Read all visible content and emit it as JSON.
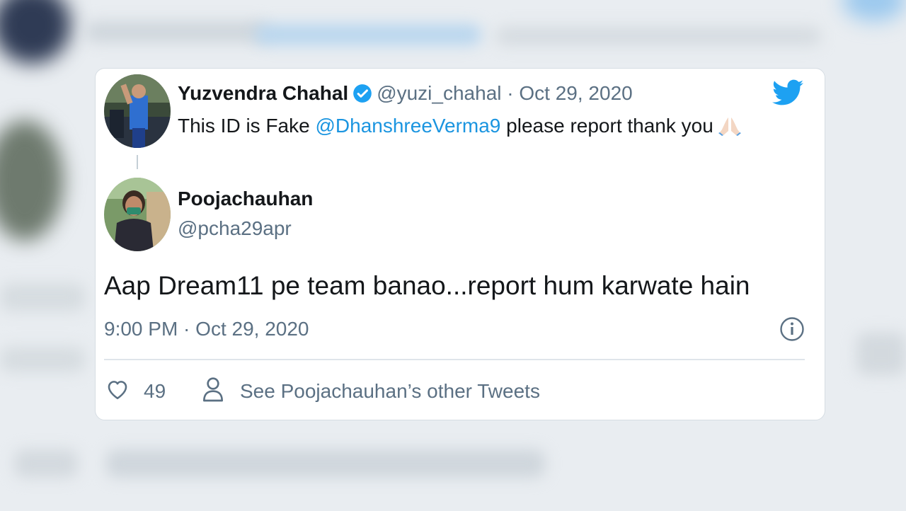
{
  "quoted_tweet": {
    "author_name": "Yuzvendra Chahal",
    "author_handle": "@yuzi_chahal",
    "separator": "·",
    "date": "Oct 29, 2020",
    "text_before": "This ID is Fake",
    "mention": "@DhanshreeVerma9",
    "text_after": "please report thank you",
    "emoji": "folded-hands"
  },
  "reply": {
    "author_name": "Poojachauhan",
    "author_handle": "@pcha29apr",
    "text": "Aap Dream11 pe team banao...report hum karwate hain",
    "timestamp": "9:00 PM · Oct 29, 2020"
  },
  "actions": {
    "like_count": "49",
    "other_tweets_label": "See Poojachauhan’s other Tweets"
  },
  "colors": {
    "twitter_blue": "#1da1f2",
    "mention_blue": "#1b95e0",
    "muted_text": "#5b7083"
  },
  "icons": [
    "twitter-bird-icon",
    "verified-badge-icon",
    "info-icon",
    "heart-icon",
    "person-icon"
  ]
}
